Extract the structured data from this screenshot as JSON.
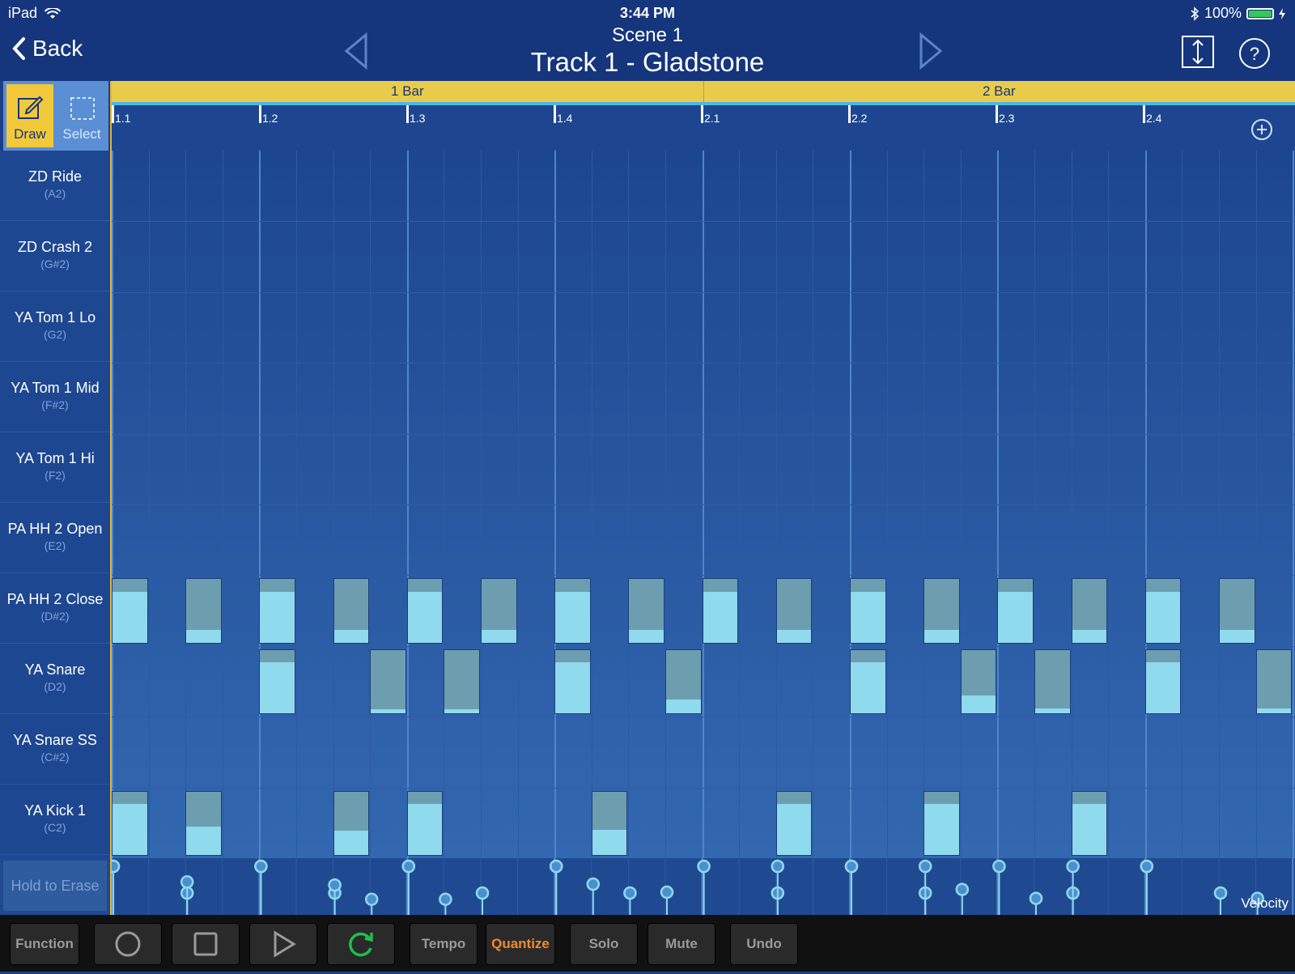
{
  "status_bar": {
    "device": "iPad",
    "time": "3:44 PM",
    "battery": "100%"
  },
  "header": {
    "back_label": "Back",
    "scene": "Scene  1",
    "track": "Track 1 - Gladstone"
  },
  "tools": {
    "draw_label": "Draw",
    "select_label": "Select"
  },
  "ruler": {
    "bars": [
      "1 Bar",
      "2 Bar"
    ],
    "beats": [
      "1.1",
      "1.2",
      "1.3",
      "1.4",
      "2.1",
      "2.2",
      "2.3",
      "2.4"
    ]
  },
  "instruments": [
    {
      "name": "ZD Ride",
      "note": "(A2)"
    },
    {
      "name": "ZD Crash 2",
      "note": "(G#2)"
    },
    {
      "name": "YA Tom 1 Lo",
      "note": "(G2)"
    },
    {
      "name": "YA Tom 1 Mid",
      "note": "(F#2)"
    },
    {
      "name": "YA Tom 1 Hi",
      "note": "(F2)"
    },
    {
      "name": "PA HH 2 Open",
      "note": "(E2)"
    },
    {
      "name": "PA HH 2 Close",
      "note": "(D#2)"
    },
    {
      "name": "YA Snare",
      "note": "(D2)"
    },
    {
      "name": "YA Snare SS",
      "note": "(C#2)"
    },
    {
      "name": "YA Kick 1",
      "note": "(C2)"
    }
  ],
  "notes": [
    {
      "row": 6,
      "step": 0,
      "velocity": 0.8
    },
    {
      "row": 6,
      "step": 2,
      "velocity": 0.2
    },
    {
      "row": 6,
      "step": 4,
      "velocity": 0.8
    },
    {
      "row": 6,
      "step": 6,
      "velocity": 0.2
    },
    {
      "row": 6,
      "step": 8,
      "velocity": 0.8
    },
    {
      "row": 6,
      "step": 10,
      "velocity": 0.2
    },
    {
      "row": 6,
      "step": 12,
      "velocity": 0.8
    },
    {
      "row": 6,
      "step": 14,
      "velocity": 0.2
    },
    {
      "row": 6,
      "step": 16,
      "velocity": 0.8
    },
    {
      "row": 6,
      "step": 18,
      "velocity": 0.2
    },
    {
      "row": 6,
      "step": 20,
      "velocity": 0.8
    },
    {
      "row": 6,
      "step": 22,
      "velocity": 0.2
    },
    {
      "row": 6,
      "step": 24,
      "velocity": 0.8
    },
    {
      "row": 6,
      "step": 26,
      "velocity": 0.2
    },
    {
      "row": 6,
      "step": 28,
      "velocity": 0.8
    },
    {
      "row": 6,
      "step": 30,
      "velocity": 0.2
    },
    {
      "row": 7,
      "step": 4,
      "velocity": 0.8
    },
    {
      "row": 7,
      "step": 7,
      "velocity": 0.06
    },
    {
      "row": 7,
      "step": 9,
      "velocity": 0.06
    },
    {
      "row": 7,
      "step": 12,
      "velocity": 0.8
    },
    {
      "row": 7,
      "step": 15,
      "velocity": 0.22
    },
    {
      "row": 7,
      "step": 20,
      "velocity": 0.8
    },
    {
      "row": 7,
      "step": 23,
      "velocity": 0.28
    },
    {
      "row": 7,
      "step": 25,
      "velocity": 0.08
    },
    {
      "row": 7,
      "step": 28,
      "velocity": 0.8
    },
    {
      "row": 7,
      "step": 31,
      "velocity": 0.08
    },
    {
      "row": 9,
      "step": 0,
      "velocity": 0.8
    },
    {
      "row": 9,
      "step": 2,
      "velocity": 0.45
    },
    {
      "row": 9,
      "step": 6,
      "velocity": 0.38
    },
    {
      "row": 9,
      "step": 8,
      "velocity": 0.8
    },
    {
      "row": 9,
      "step": 13,
      "velocity": 0.4
    },
    {
      "row": 9,
      "step": 18,
      "velocity": 0.8
    },
    {
      "row": 9,
      "step": 22,
      "velocity": 0.8
    },
    {
      "row": 9,
      "step": 26,
      "velocity": 0.8
    }
  ],
  "velocity_lane": {
    "hold_label": "Hold to Erase",
    "label": "Velocity"
  },
  "toolbar": {
    "function_label": "Function",
    "tempo_label": "Tempo",
    "quantize_label": "Quantize",
    "solo_label": "Solo",
    "mute_label": "Mute",
    "undo_label": "Undo"
  },
  "colors": {
    "accent": "#e9cb4c",
    "note_light": "#8fdaec",
    "note_dark": "#6d9eb0",
    "quantize": "#f08c2c",
    "loop": "#1fbf4a"
  },
  "icons": [
    "back-chevron-icon",
    "prev-triangle-icon",
    "next-triangle-icon",
    "resize-vertical-icon",
    "help-icon",
    "draw-pencil-icon",
    "select-marquee-icon",
    "add-circle-icon",
    "record-circle-icon",
    "stop-square-icon",
    "play-triangle-icon",
    "loop-arrows-icon"
  ]
}
